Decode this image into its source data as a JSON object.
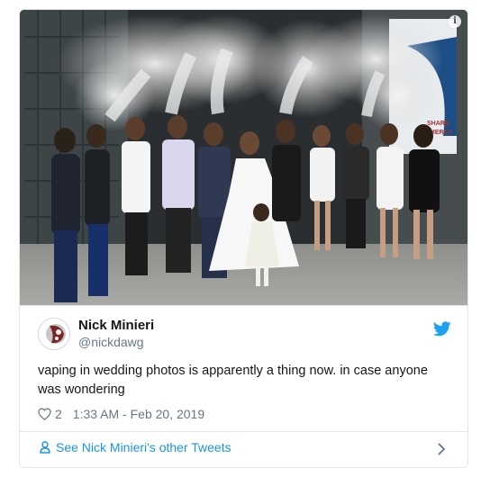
{
  "photo": {
    "alt_subject": "wedding-group-vaping-photo",
    "sign_text": [
      "SHARE",
      "MERCY"
    ]
  },
  "tweet": {
    "author_name": "Nick Minieri",
    "author_handle": "@nickdawg",
    "text": "vaping in wedding photos is apparently a thing now. in case anyone was wondering",
    "like_count": "2",
    "timestamp": "1:33 AM - Feb 20, 2019"
  },
  "footer": {
    "link_text": "See Nick Minieri's other Tweets"
  },
  "icons": [
    "info-icon",
    "twitter-bird-icon",
    "heart-icon",
    "person-icon",
    "chevron-right-icon"
  ],
  "colors": {
    "twitter_blue": "#1da1f2",
    "link_blue": "#1b95e0",
    "muted": "#657786",
    "border": "#e1e8ed"
  }
}
